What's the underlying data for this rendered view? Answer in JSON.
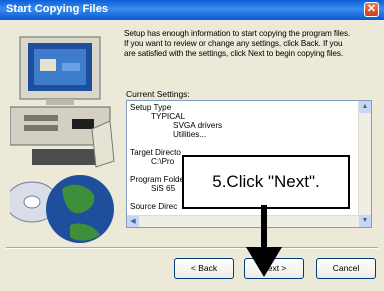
{
  "window": {
    "title": "Start Copying Files",
    "close_glyph": "✕"
  },
  "description": [
    "Setup has enough information to start copying the program files.",
    "If you want to review or change any settings, click Back.  If you",
    "are satisfied with the settings, click Next to begin copying files."
  ],
  "current_settings_label": "Current Settings:",
  "settings": {
    "setup_type_label": "Setup Type",
    "setup_type_value": "TYPICAL",
    "item1": "SVGA drivers",
    "item2": "Utilities...",
    "target_label": "Target Directo",
    "target_value": "C:\\Pro",
    "program_folder_label": "Program Folde",
    "program_folder_value": "SiS 65",
    "source_label": "Source Direc"
  },
  "callout": {
    "text": "5.Click \"Next\"."
  },
  "buttons": {
    "back": "< Back",
    "next": "Next >",
    "cancel": "Cancel"
  },
  "colors": {
    "titlebar": "#0a5fd8",
    "callout_border": "#000000",
    "arrow": "#000000"
  }
}
